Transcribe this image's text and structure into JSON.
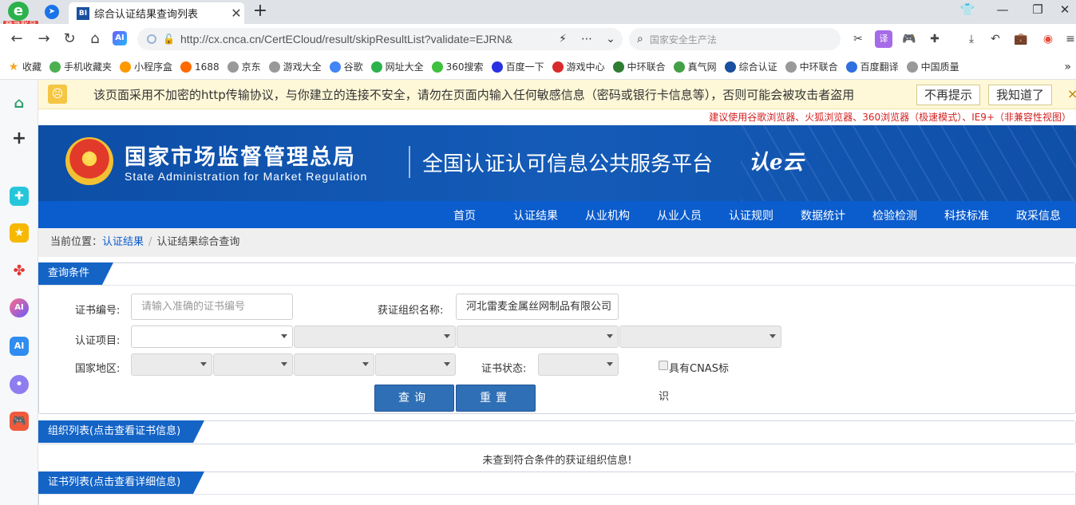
{
  "browser": {
    "login_badge": "登录账号",
    "tab_favicon": "BI",
    "tab_title": "综合认证结果查询列表",
    "new_tab": "+",
    "url": "http://cx.cnca.cn/CertECloud/result/skipResultList?validate=EJRN&",
    "search_text": "国家安全生产法",
    "ai_label": "AI"
  },
  "bookmarks": [
    {
      "label": "收藏",
      "color": "#f5a623"
    },
    {
      "label": "手机收藏夹",
      "color": "#4caf50"
    },
    {
      "label": "小程序盒",
      "color": "#ff9800"
    },
    {
      "label": "1688",
      "color": "#ff6a00"
    },
    {
      "label": "京东",
      "color": "#999999"
    },
    {
      "label": "游戏大全",
      "color": "#999999"
    },
    {
      "label": "谷歌",
      "color": "#4285f4"
    },
    {
      "label": "网址大全",
      "color": "#2bb24c"
    },
    {
      "label": "360搜索",
      "color": "#3ec13e"
    },
    {
      "label": "百度一下",
      "color": "#2932e1"
    },
    {
      "label": "游戏中心",
      "color": "#d92b2b"
    },
    {
      "label": "中环联合",
      "color": "#2e7d32"
    },
    {
      "label": "真气网",
      "color": "#43a047"
    },
    {
      "label": "综合认证",
      "color": "#1a4e9e"
    },
    {
      "label": "中环联合",
      "color": "#999999"
    },
    {
      "label": "百度翻译",
      "color": "#2f6fe0"
    },
    {
      "label": "中国质量",
      "color": "#999999"
    }
  ],
  "warning": {
    "text": "该页面采用不加密的http传输协议，与你建立的连接不安全，请勿在页面内输入任何敏感信息（密码或银行卡信息等），否则可能会被攻击者盗用",
    "dismiss_forever": "不再提示",
    "acknowledge": "我知道了",
    "close": "×"
  },
  "browser_tip": "建议使用谷歌浏览器、火狐浏览器、360浏览器（极速模式）、IE9+（非兼容性视图）",
  "header": {
    "agency_cn": "国家市场监督管理总局",
    "agency_en": "State Administration  for  Market Regulation",
    "platform_title": "全国认证认可信息公共服务平台",
    "platform_logo": "认e云"
  },
  "nav": [
    "首页",
    "认证结果",
    "从业机构",
    "从业人员",
    "认证规则",
    "数据统计",
    "检验检测",
    "科技标准",
    "政采信息"
  ],
  "breadcrumb": {
    "prefix": "当前位置：",
    "link": "认证结果",
    "separator": "/",
    "current": "认证结果综合查询"
  },
  "query": {
    "title": "查询条件",
    "cert_no_label": "证书编号:",
    "cert_no_placeholder": "请输入准确的证书编号",
    "org_label": "获证组织名称:",
    "org_value": "河北雷麦金属丝网制品有限公司",
    "project_label": "认证项目:",
    "region_label": "国家地区:",
    "status_label": "证书状态:",
    "cnas_label_1": "具有CNAS标",
    "cnas_label_2": "识",
    "search_button": "查询",
    "reset_button": "重置"
  },
  "org_list": {
    "title": "组织列表(点击查看证书信息)",
    "empty_message": "未查到符合条件的获证组织信息!"
  },
  "cert_list": {
    "title": "证书列表(点击查看详细信息)"
  }
}
